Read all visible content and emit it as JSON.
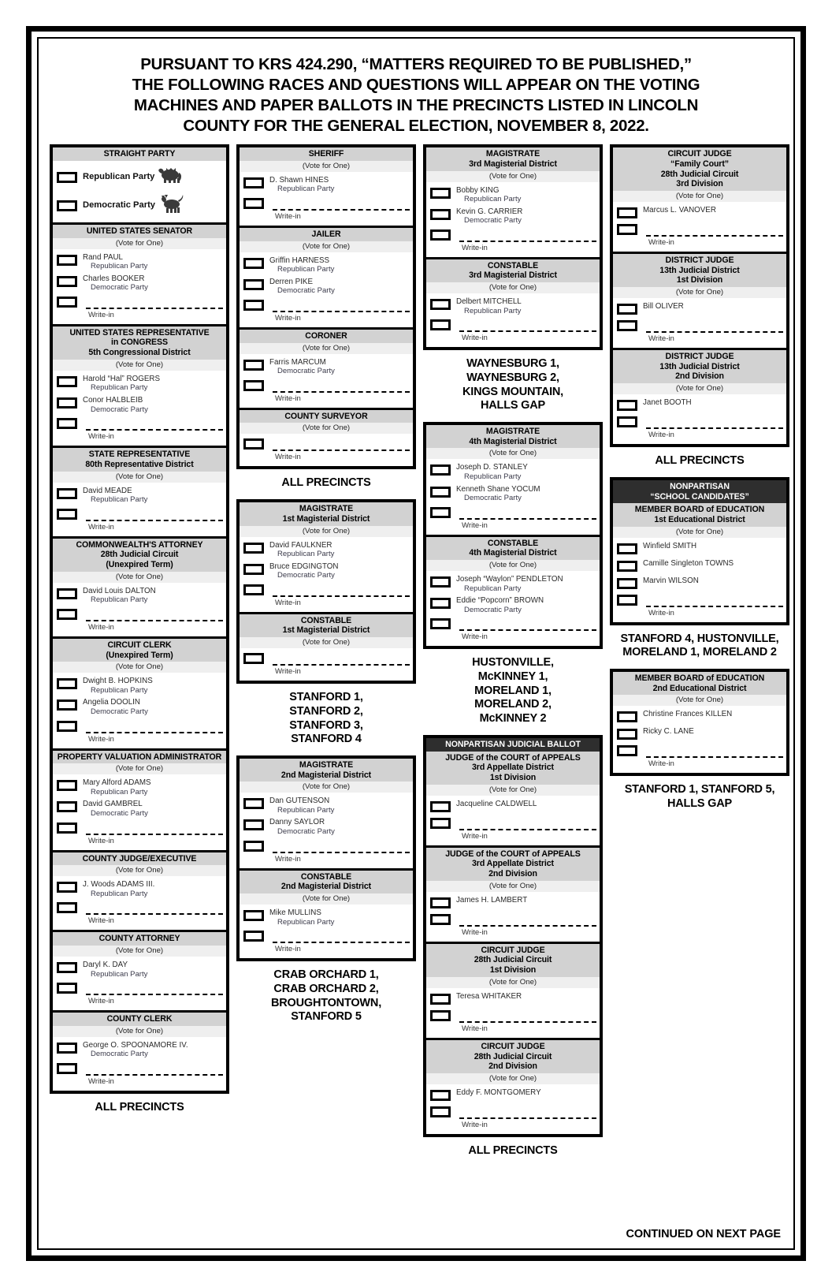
{
  "header": {
    "line1": "PURSUANT TO KRS 424.290, “MATTERS REQUIRED TO BE PUBLISHED,”",
    "line2": "THE FOLLOWING RACES AND QUESTIONS WILL APPEAR ON THE VOTING",
    "line3": "MACHINES AND PAPER BALLOTS IN THE PRECINCTS LISTED IN LINCOLN",
    "line4": "COUNTY FOR THE GENERAL ELECTION, NOVEMBER 8, 2022."
  },
  "footer": {
    "continued": "CONTINUED ON NEXT PAGE"
  },
  "labels": {
    "vote_for_one": "(Vote for One)",
    "write_in": "Write-in",
    "all_precincts": "ALL PRECINCTS"
  },
  "col1": {
    "card1": {
      "contests": [
        {
          "title_lines": [
            "STRAIGHT PARTY"
          ],
          "subtitle": "",
          "straight_party": true,
          "options": [
            {
              "name": "Republican Party",
              "icon": "elephant-icon"
            },
            {
              "name": "Democratic Party",
              "icon": "donkey-icon"
            }
          ],
          "write_in": false
        },
        {
          "title_lines": [
            "UNITED STATES SENATOR"
          ],
          "subtitle": "(Vote for One)",
          "options": [
            {
              "name": "Rand PAUL",
              "party": "Republican Party"
            },
            {
              "name": "Charles BOOKER",
              "party": "Democratic Party"
            }
          ],
          "write_in": true
        },
        {
          "title_lines": [
            "UNITED STATES REPRESENTATIVE",
            "in CONGRESS",
            "5th Congressional District"
          ],
          "subtitle": "(Vote for One)",
          "options": [
            {
              "name": "Harold “Hal” ROGERS",
              "party": "Republican Party"
            },
            {
              "name": "Conor HALBLEIB",
              "party": "Democratic Party"
            }
          ],
          "write_in": true
        },
        {
          "title_lines": [
            "STATE REPRESENTATIVE",
            "80th Representative District"
          ],
          "subtitle": "(Vote for One)",
          "options": [
            {
              "name": "David MEADE",
              "party": "Republican Party"
            }
          ],
          "write_in": true
        },
        {
          "title_lines": [
            "COMMONWEALTH'S ATTORNEY",
            "28th Judicial Circuit",
            "(Unexpired Term)"
          ],
          "subtitle": "(Vote for One)",
          "options": [
            {
              "name": "David Louis DALTON",
              "party": "Republican Party"
            }
          ],
          "write_in": true
        },
        {
          "title_lines": [
            "CIRCUIT CLERK",
            "(Unexpired Term)"
          ],
          "subtitle": "(Vote for One)",
          "options": [
            {
              "name": "Dwight B. HOPKINS",
              "party": "Republican Party"
            },
            {
              "name": "Angelia DOOLIN",
              "party": "Democratic Party"
            }
          ],
          "write_in": true
        },
        {
          "title_lines": [
            "PROPERTY VALUATION ADMINISTRATOR"
          ],
          "subtitle": "(Vote for One)",
          "options": [
            {
              "name": "Mary Alford ADAMS",
              "party": "Republican Party"
            },
            {
              "name": "David GAMBREL",
              "party": "Democratic Party"
            }
          ],
          "write_in": true
        },
        {
          "title_lines": [
            "COUNTY JUDGE/EXECUTIVE"
          ],
          "subtitle": "(Vote for One)",
          "options": [
            {
              "name": "J. Woods ADAMS III.",
              "party": "Republican Party"
            }
          ],
          "write_in": true
        },
        {
          "title_lines": [
            "COUNTY ATTORNEY"
          ],
          "subtitle": "(Vote for One)",
          "options": [
            {
              "name": "Daryl K. DAY",
              "party": "Republican Party"
            }
          ],
          "write_in": true
        },
        {
          "title_lines": [
            "COUNTY CLERK"
          ],
          "subtitle": "(Vote for One)",
          "options": [
            {
              "name": "George O. SPOONAMORE IV.",
              "party": "Democratic Party"
            }
          ],
          "write_in": true
        }
      ],
      "precinct_note": "ALL PRECINCTS"
    }
  },
  "col2": {
    "card1": {
      "contests": [
        {
          "title_lines": [
            "SHERIFF"
          ],
          "subtitle": "(Vote for One)",
          "options": [
            {
              "name": "D. Shawn HINES",
              "party": "Republican Party"
            }
          ],
          "write_in": true
        },
        {
          "title_lines": [
            "JAILER"
          ],
          "subtitle": "(Vote for One)",
          "options": [
            {
              "name": "Griffin HARNESS",
              "party": "Republican Party"
            },
            {
              "name": "Derren PIKE",
              "party": "Democratic Party"
            }
          ],
          "write_in": true
        },
        {
          "title_lines": [
            "CORONER"
          ],
          "subtitle": "(Vote for One)",
          "options": [
            {
              "name": "Farris MARCUM",
              "party": "Democratic Party"
            }
          ],
          "write_in": true
        },
        {
          "title_lines": [
            "COUNTY SURVEYOR"
          ],
          "subtitle": "(Vote for One)",
          "options": [],
          "write_in": true
        }
      ],
      "precinct_note": "ALL PRECINCTS"
    },
    "card2": {
      "contests": [
        {
          "title_lines": [
            "MAGISTRATE",
            "1st Magisterial District"
          ],
          "subtitle": "(Vote for One)",
          "options": [
            {
              "name": "David FAULKNER",
              "party": "Republican Party"
            },
            {
              "name": "Bruce EDGINGTON",
              "party": "Democratic Party"
            }
          ],
          "write_in": true
        },
        {
          "title_lines": [
            "CONSTABLE",
            "1st Magisterial District"
          ],
          "subtitle": "(Vote for One)",
          "options": [],
          "write_in": true
        }
      ],
      "precinct_note": "STANFORD 1,\nSTANFORD 2,\nSTANFORD 3,\nSTANFORD 4"
    },
    "card3": {
      "contests": [
        {
          "title_lines": [
            "MAGISTRATE",
            "2nd Magisterial District"
          ],
          "subtitle": "(Vote for One)",
          "options": [
            {
              "name": "Dan GUTENSON",
              "party": "Republican Party"
            },
            {
              "name": "Danny SAYLOR",
              "party": "Democratic Party"
            }
          ],
          "write_in": true
        },
        {
          "title_lines": [
            "CONSTABLE",
            "2nd Magisterial District"
          ],
          "subtitle": "(Vote for One)",
          "options": [
            {
              "name": "Mike MULLINS",
              "party": "Republican Party"
            }
          ],
          "write_in": true
        }
      ],
      "precinct_note": "CRAB ORCHARD 1,\nCRAB ORCHARD 2,\nBROUGHTONTOWN,\nSTANFORD 5"
    }
  },
  "col3": {
    "card1": {
      "contests": [
        {
          "title_lines": [
            "MAGISTRATE",
            "3rd Magisterial District"
          ],
          "subtitle": "(Vote for One)",
          "options": [
            {
              "name": "Bobby KING",
              "party": "Republican Party"
            },
            {
              "name": "Kevin G. CARRIER",
              "party": "Democratic Party"
            }
          ],
          "write_in": true
        },
        {
          "title_lines": [
            "CONSTABLE",
            "3rd Magisterial District"
          ],
          "subtitle": "(Vote for One)",
          "options": [
            {
              "name": "Delbert MITCHELL",
              "party": "Republican Party"
            }
          ],
          "write_in": true
        }
      ],
      "precinct_note": "WAYNESBURG 1,\nWAYNESBURG 2,\nKINGS MOUNTAIN,\nHALLS GAP"
    },
    "card2": {
      "contests": [
        {
          "title_lines": [
            "MAGISTRATE",
            "4th Magisterial District"
          ],
          "subtitle": "(Vote for One)",
          "options": [
            {
              "name": "Joseph D. STANLEY",
              "party": "Republican Party"
            },
            {
              "name": "Kenneth Shane YOCUM",
              "party": "Democratic Party"
            }
          ],
          "write_in": true
        },
        {
          "title_lines": [
            "CONSTABLE",
            "4th Magisterial District"
          ],
          "subtitle": "(Vote for One)",
          "options": [
            {
              "name": "Joseph “Waylon” PENDLETON",
              "party": "Republican Party"
            },
            {
              "name": "Eddie “Popcorn” BROWN",
              "party": "Democratic Party"
            }
          ],
          "write_in": true
        }
      ],
      "precinct_note": "HUSTONVILLE,\nMcKINNEY 1,\nMORELAND 1,\nMORELAND 2,\nMcKINNEY 2"
    },
    "card3": {
      "banner": "NONPARTISAN JUDICIAL BALLOT",
      "contests": [
        {
          "title_lines": [
            "JUDGE of the COURT of APPEALS",
            "3rd Appellate District",
            "1st Division"
          ],
          "subtitle": "(Vote for One)",
          "options": [
            {
              "name": "Jacqueline CALDWELL"
            }
          ],
          "write_in": true
        },
        {
          "title_lines": [
            "JUDGE of the COURT of APPEALS",
            "3rd Appellate District",
            "2nd Division"
          ],
          "subtitle": "(Vote for One)",
          "options": [
            {
              "name": "James H. LAMBERT"
            }
          ],
          "write_in": true
        },
        {
          "title_lines": [
            "CIRCUIT JUDGE",
            "28th Judicial Circuit",
            "1st Division"
          ],
          "subtitle": "(Vote for One)",
          "options": [
            {
              "name": "Teresa WHITAKER"
            }
          ],
          "write_in": true
        },
        {
          "title_lines": [
            "CIRCUIT JUDGE",
            "28th Judicial Circuit",
            "2nd Division"
          ],
          "subtitle": "(Vote for One)",
          "options": [
            {
              "name": "Eddy F. MONTGOMERY"
            }
          ],
          "write_in": true
        }
      ],
      "precinct_note": "ALL PRECINCTS"
    }
  },
  "col4": {
    "card1": {
      "contests": [
        {
          "title_lines": [
            "CIRCUIT JUDGE",
            "“Family Court”",
            "28th Judicial Circuit",
            "3rd Division"
          ],
          "subtitle": "(Vote for One)",
          "options": [
            {
              "name": "Marcus L. VANOVER"
            }
          ],
          "write_in": true
        },
        {
          "title_lines": [
            "DISTRICT JUDGE",
            "13th Judicial District",
            "1st Division"
          ],
          "subtitle": "(Vote for One)",
          "options": [
            {
              "name": "Bill OLIVER"
            }
          ],
          "write_in": true
        },
        {
          "title_lines": [
            "DISTRICT JUDGE",
            "13th Judicial District",
            "2nd Division"
          ],
          "subtitle": "(Vote for One)",
          "options": [
            {
              "name": "Janet BOOTH"
            }
          ],
          "write_in": true
        }
      ],
      "precinct_note": "ALL PRECINCTS"
    },
    "card2": {
      "banner_lines": [
        "NONPARTISAN",
        "“SCHOOL CANDIDATES”"
      ],
      "contests": [
        {
          "title_lines": [
            "MEMBER BOARD of EDUCATION",
            "1st Educational District"
          ],
          "subtitle": "(Vote for One)",
          "options": [
            {
              "name": "Winfield SMITH"
            },
            {
              "name": "Camille Singleton TOWNS"
            },
            {
              "name": "Marvin WILSON"
            }
          ],
          "write_in": true
        }
      ],
      "precinct_note": "STANFORD 4, HUSTONVILLE,\nMORELAND 1, MORELAND 2"
    },
    "card3": {
      "contests": [
        {
          "title_lines": [
            "MEMBER BOARD of EDUCATION",
            "2nd Educational District"
          ],
          "subtitle": "(Vote for One)",
          "options": [
            {
              "name": "Christine Frances KILLEN"
            },
            {
              "name": "Ricky C. LANE"
            }
          ],
          "write_in": true
        }
      ],
      "precinct_note": "STANFORD 1, STANFORD 5,\nHALLS GAP"
    }
  }
}
